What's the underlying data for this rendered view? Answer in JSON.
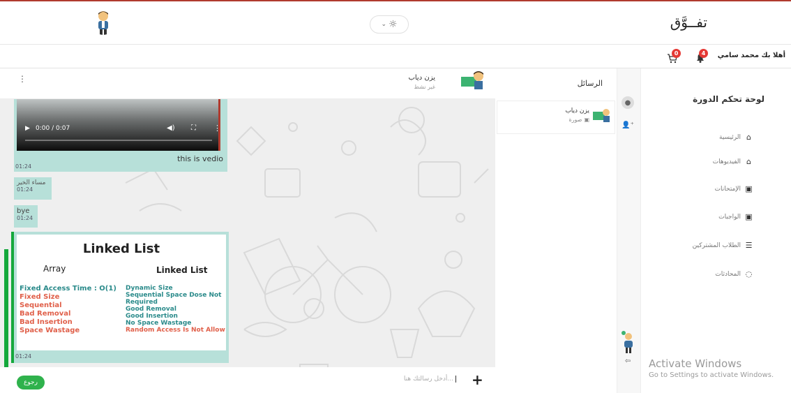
{
  "header": {
    "brand": "تفــوَّق",
    "greeting": "أهلا بك محمد سامي",
    "notifications_count": "4",
    "cart_count": "0"
  },
  "sidebar": {
    "title": "لوحة تحكم الدورة",
    "items": [
      {
        "label": "الرئيسية",
        "icon": "home-icon"
      },
      {
        "label": "الفيديوهات",
        "icon": "home-icon"
      },
      {
        "label": "الإمتحانات",
        "icon": "user-badge-icon"
      },
      {
        "label": "الواجبات",
        "icon": "user-badge-icon"
      },
      {
        "label": "الطلاب المشتركين",
        "icon": "list-icon"
      },
      {
        "label": "المحادثات",
        "icon": "chat-icon"
      }
    ]
  },
  "watermark": {
    "line1": "Activate Windows",
    "line2": "Go to Settings to activate Windows."
  },
  "conversations": {
    "title": "الرسائل",
    "items": [
      {
        "name": "يزن دياب",
        "preview": "صورة"
      }
    ]
  },
  "chat": {
    "contact_name": "يزن دياب",
    "contact_status": "غير نشط",
    "video": {
      "time": "0:00 / 0:07",
      "caption": "this is vedio",
      "timestamp": "01:24"
    },
    "messages": [
      {
        "text": "مساء الخير",
        "time": "01:24"
      },
      {
        "text": "bye",
        "time": "01:24"
      }
    ],
    "image_message": {
      "title": "Linked List",
      "left_heading": "Array",
      "right_heading": "Linked List",
      "left_lines": [
        {
          "text": "Fixed Access Time : O(1)",
          "color": "#2a8a8a"
        },
        {
          "text": "Fixed Size",
          "color": "#e0604a"
        },
        {
          "text": "Sequential",
          "color": "#e0604a"
        },
        {
          "text": "Bad Removal",
          "color": "#e0604a"
        },
        {
          "text": "Bad Insertion",
          "color": "#e0604a"
        },
        {
          "text": "Space Wastage",
          "color": "#e0604a"
        }
      ],
      "right_lines": [
        {
          "text": "Dynamic Size",
          "color": "#2a8a8a"
        },
        {
          "text": "Sequential Space Dose Not",
          "color": "#2a8a8a"
        },
        {
          "text": "Required",
          "color": "#2a8a8a"
        },
        {
          "text": "Good Removal",
          "color": "#2a8a8a"
        },
        {
          "text": "Good Insertion",
          "color": "#2a8a8a"
        },
        {
          "text": "No Space Wastage",
          "color": "#2a8a8a"
        },
        {
          "text": "Random Access Is Not Allow",
          "color": "#e0604a"
        }
      ],
      "time": "01:24"
    },
    "input_placeholder": "أدخل رسالتك هنا...",
    "back_label": "رجوع"
  },
  "colors": {
    "accent": "#2fb24c",
    "bubble": "#b7e0d9",
    "badge": "#e53935",
    "top_border": "#b03a2e"
  }
}
